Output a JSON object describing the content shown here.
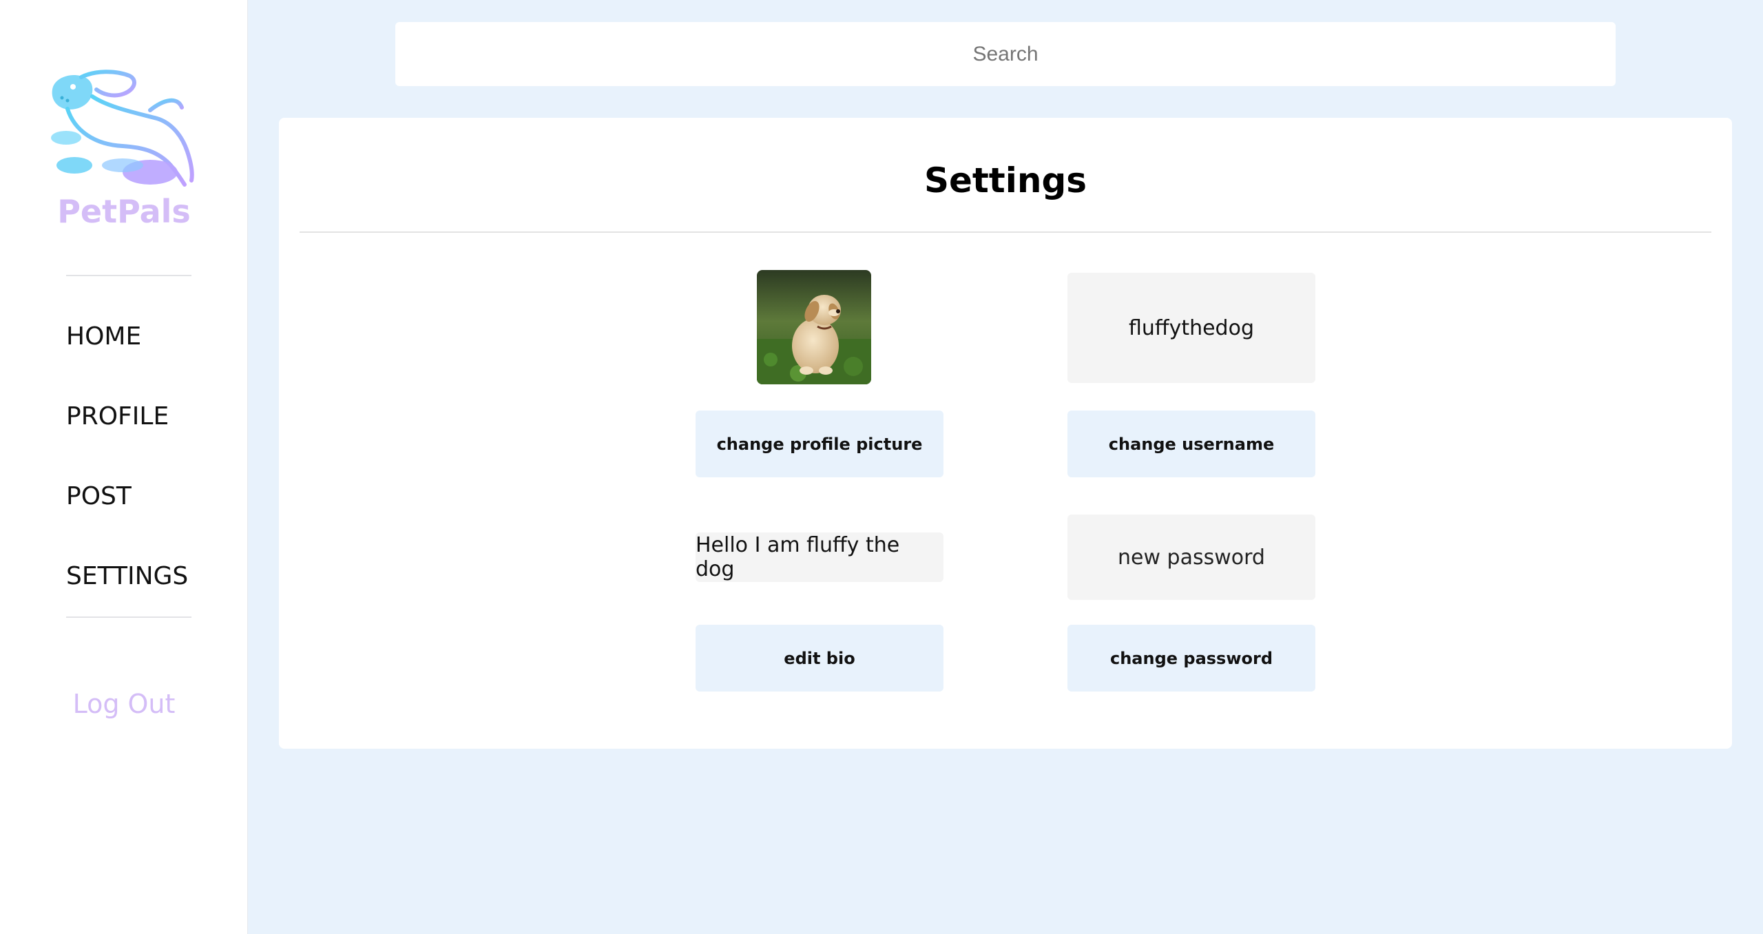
{
  "brand": {
    "name": "PetPals",
    "logo_icon": "dog-logo-icon",
    "gradient": [
      "#62d2f7",
      "#b9a4ff"
    ],
    "text_color": "#d4bdf7"
  },
  "nav": {
    "items": [
      {
        "label": "HOME"
      },
      {
        "label": "PROFILE"
      },
      {
        "label": "POST"
      },
      {
        "label": "SETTINGS"
      }
    ],
    "logout_label": "Log Out"
  },
  "search": {
    "placeholder": "Search",
    "value": ""
  },
  "settings": {
    "title": "Settings",
    "profile_picture_alt": "puppy sitting on grass",
    "username_value": "fluffythedog",
    "bio_value": "Hello I am fluffy the dog",
    "password_placeholder": "new password",
    "buttons": {
      "change_picture": "change profile picture",
      "change_username": "change username",
      "edit_bio": "edit bio",
      "change_password": "change password"
    }
  },
  "colors": {
    "background": "#e8f2fc",
    "button_bg": "#e8f2fc",
    "field_bg": "#f4f4f4",
    "accent": "#d4bdf7"
  }
}
